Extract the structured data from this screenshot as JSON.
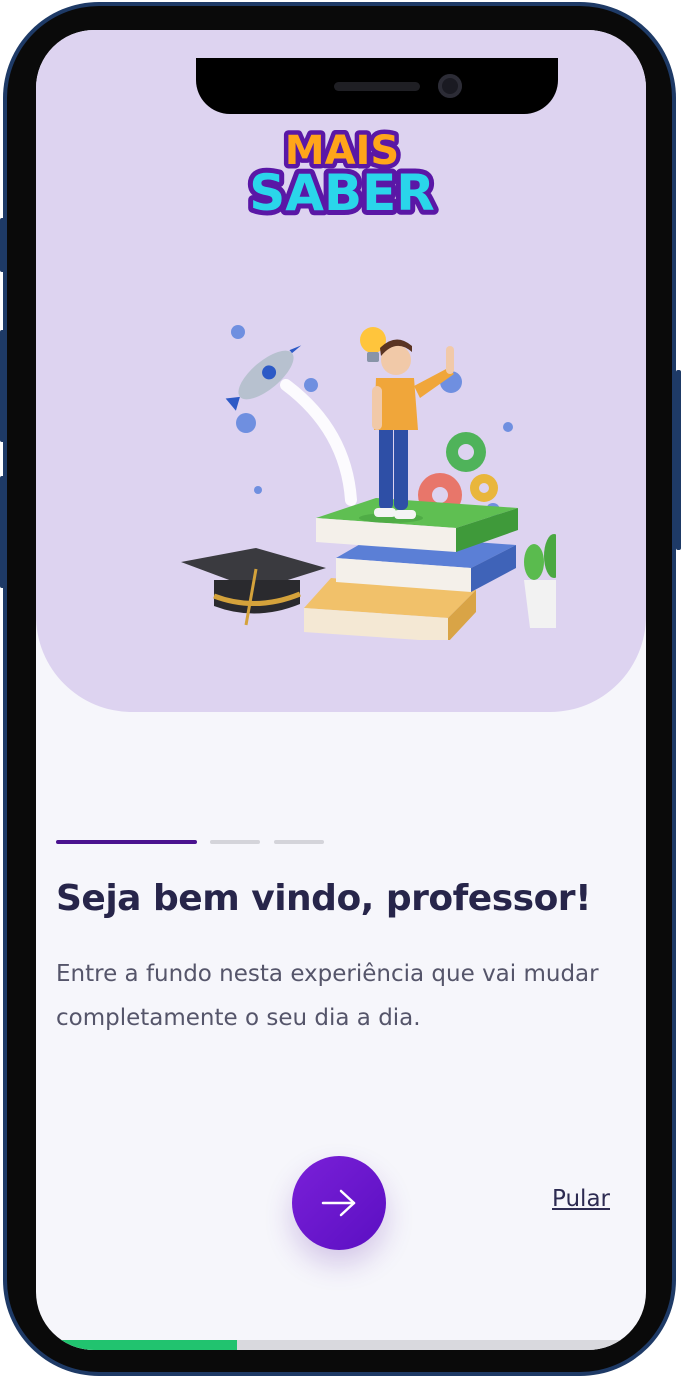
{
  "app": {
    "logo_top": "MAIS",
    "logo_bottom": "SABER"
  },
  "onboarding": {
    "step": 1,
    "total_steps": 3,
    "title": "Seja bem vindo, professor!",
    "description": "Entre a fundo nesta experiência que vai mudar completamente o seu dia a dia.",
    "skip_label": "Pular",
    "next_icon": "arrow-right-icon",
    "bottom_progress": 0.33
  },
  "colors": {
    "hero_bg": "#ddd3f0",
    "accent": "#5b0fc2",
    "progress_active": "#4a128f",
    "progress_inactive": "#d4d4da",
    "bottom_progress": "#21c36f"
  }
}
